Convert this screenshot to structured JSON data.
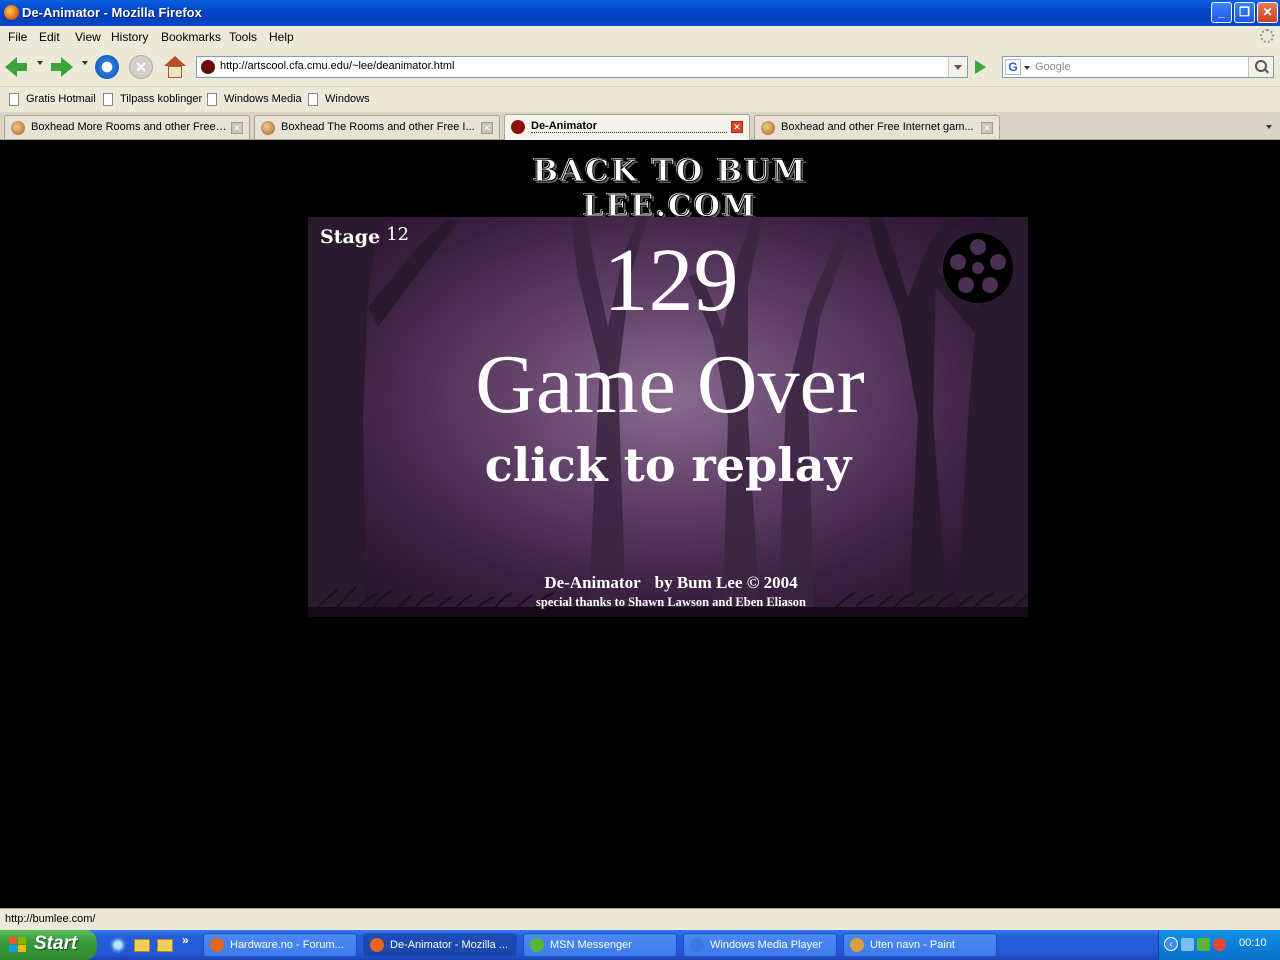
{
  "window": {
    "title": "De-Animator - Mozilla Firefox"
  },
  "menu": [
    "File",
    "Edit",
    "View",
    "History",
    "Bookmarks",
    "Tools",
    "Help"
  ],
  "toolbar": {
    "url": "http://artscool.cfa.cmu.edu/~lee/deanimator.html",
    "search_placeholder": "Google"
  },
  "bookmarks": [
    "Gratis Hotmail",
    "Tilpass koblinger",
    "Windows Media",
    "Windows"
  ],
  "tabs": [
    {
      "label": "Boxhead More Rooms and other Free ...",
      "active": false
    },
    {
      "label": "Boxhead The Rooms and other Free I...",
      "active": false
    },
    {
      "label": "De-Animator",
      "active": true
    },
    {
      "label": "Boxhead and other Free Internet gam...",
      "active": false
    }
  ],
  "page": {
    "back_link": "BACK TO BUM LEE.COM",
    "game": {
      "stage_label": "Stage",
      "stage_number": "12",
      "score": "129",
      "game_over": "Game Over",
      "replay": "click to replay",
      "credit_title": "De-Animator",
      "credit_author": "by Bum Lee © 2004",
      "thanks": "special thanks to Shawn Lawson and Eben Eliason"
    }
  },
  "status": {
    "text": "http://bumlee.com/"
  },
  "taskbar": {
    "start_label": "Start",
    "more": "»",
    "tasks": [
      {
        "label": "Hardware.no - Forum...",
        "active": false,
        "color": "#e2661c"
      },
      {
        "label": "De-Animator - Mozilla ...",
        "active": true,
        "color": "#e2661c"
      },
      {
        "label": "MSN Messenger",
        "active": false,
        "color": "#5ab43a"
      },
      {
        "label": "Windows Media Player",
        "active": false,
        "color": "#3a78e0"
      },
      {
        "label": "Uten navn - Paint",
        "active": false,
        "color": "#d8a040"
      }
    ],
    "clock": "00:10"
  },
  "colors": {
    "titlebar": "#0346c8",
    "chrome": "#ece9d8",
    "game_bg": "#5e3d66",
    "taskbar": "#245edb",
    "start": "#3a9a3a"
  }
}
